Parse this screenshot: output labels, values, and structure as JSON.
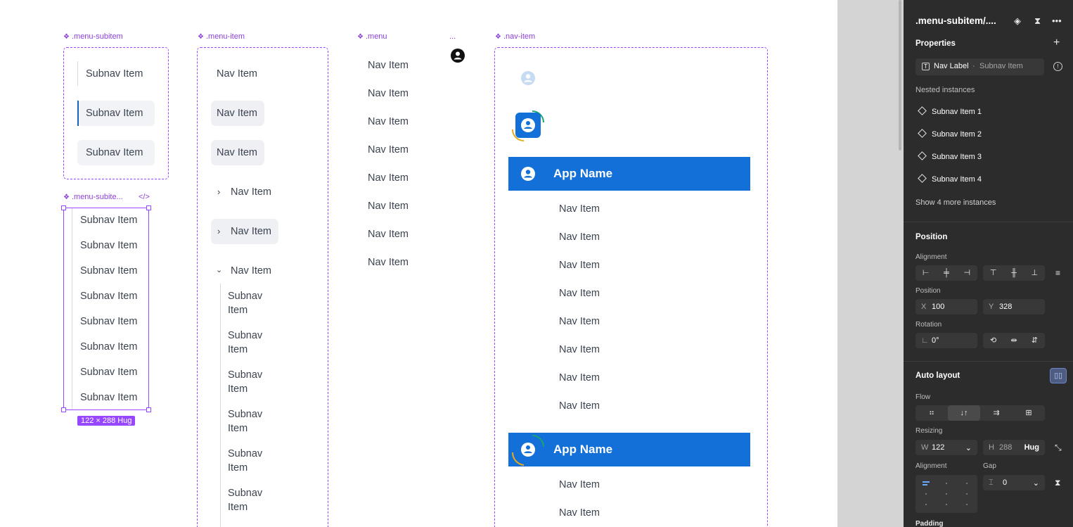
{
  "canvas": {
    "labels": {
      "menu_subitem": ".menu-subitem",
      "menu_item": ".menu-item",
      "menu": ".menu",
      "menu_ellipsis": "...",
      "nav_item": ".nav-item",
      "menu_subitem_selected": ".menu-subite...",
      "code_icon": "</>"
    },
    "subnav_label": "Subnav Item",
    "nav_label": "Nav Item",
    "subnav_wrapped_line1": "Subnav",
    "subnav_wrapped_line2": "Item",
    "app_name": "App Name",
    "size_badge": "122 × 288 Hug",
    "colors": {
      "accent": "#9747ff",
      "app_bar": "#1270d8",
      "active_line": "#1565c0"
    },
    "icons": [
      "component-diamond-icon",
      "chevron-right-icon",
      "chevron-down-icon",
      "user-avatar-icon"
    ]
  },
  "panel": {
    "title": ".menu-subitem/....",
    "properties_heading": "Properties",
    "property": {
      "label": "Nav Label",
      "sep": "·",
      "value": "Subnav Item"
    },
    "nested_heading": "Nested instances",
    "nested": [
      "Subnav Item 1",
      "Subnav Item 2",
      "Subnav Item 3",
      "Subnav Item 4"
    ],
    "show_more": "Show 4 more instances",
    "position_heading": "Position",
    "alignment_label": "Alignment",
    "position_label": "Position",
    "x_key": "X",
    "x_value": "100",
    "y_key": "Y",
    "y_value": "328",
    "rotation_label": "Rotation",
    "rotation_value": "0°",
    "auto_layout_heading": "Auto layout",
    "flow_label": "Flow",
    "resizing_label": "Resizing",
    "w_key": "W",
    "w_value": "122",
    "h_key": "H",
    "h_value": "288",
    "h_mode": "Hug",
    "alignment2_label": "Alignment",
    "gap_label": "Gap",
    "gap_value": "0",
    "padding_label": "Padding"
  }
}
